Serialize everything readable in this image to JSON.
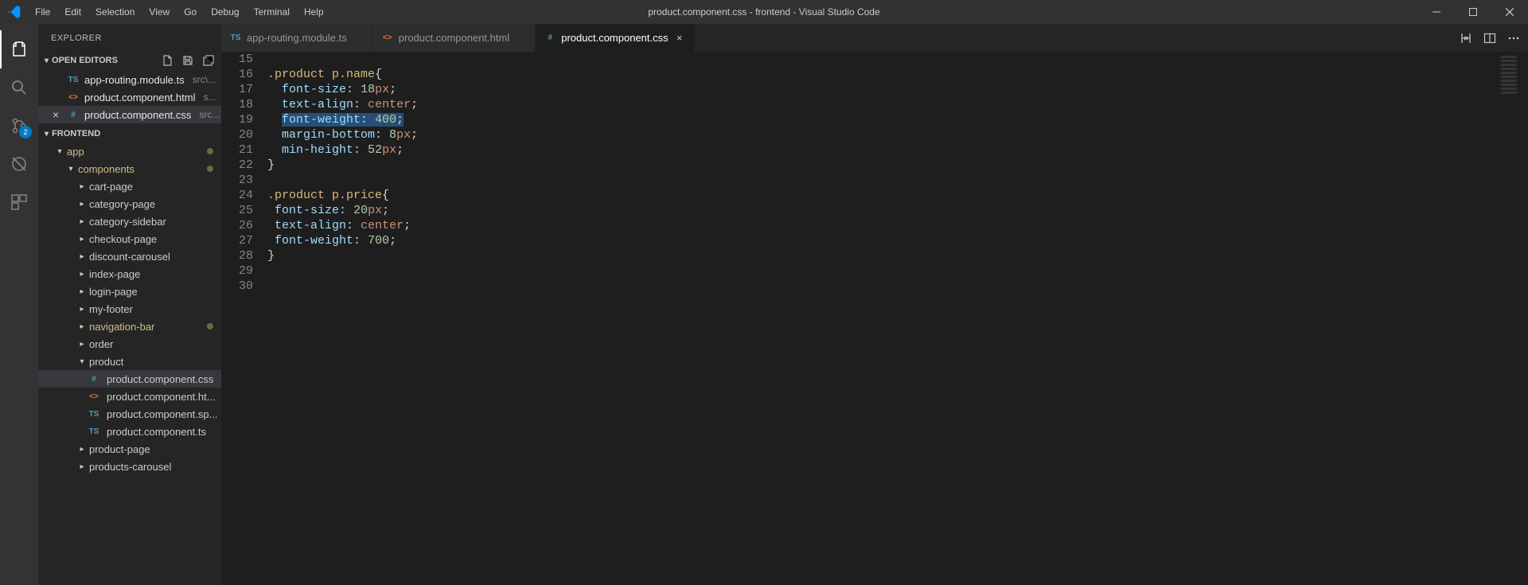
{
  "window": {
    "title": "product.component.css - frontend - Visual Studio Code"
  },
  "menu": {
    "file": "File",
    "edit": "Edit",
    "selection": "Selection",
    "view": "View",
    "go": "Go",
    "debug": "Debug",
    "terminal": "Terminal",
    "help": "Help"
  },
  "activitybar": {
    "scm_badge": "2"
  },
  "sidebar": {
    "title": "EXPLORER",
    "openEditors": {
      "header": "OPEN EDITORS",
      "items": [
        {
          "icon": "ts",
          "iconText": "TS",
          "name": "app-routing.module.ts",
          "path": "src\\..."
        },
        {
          "icon": "html",
          "iconText": "<>",
          "name": "product.component.html",
          "path": "s..."
        },
        {
          "icon": "css",
          "iconText": "#",
          "name": "product.component.css",
          "path": "src...",
          "active": true
        }
      ]
    },
    "project": {
      "header": "FRONTEND"
    },
    "tree": [
      {
        "indent": 1,
        "label": "app",
        "expanded": true,
        "twisty": "▾",
        "modified": true
      },
      {
        "indent": 2,
        "label": "components",
        "expanded": true,
        "twisty": "▾",
        "modified": true
      },
      {
        "indent": 3,
        "label": "cart-page",
        "twisty": "▸"
      },
      {
        "indent": 3,
        "label": "category-page",
        "twisty": "▸"
      },
      {
        "indent": 3,
        "label": "category-sidebar",
        "twisty": "▸"
      },
      {
        "indent": 3,
        "label": "checkout-page",
        "twisty": "▸"
      },
      {
        "indent": 3,
        "label": "discount-carousel",
        "twisty": "▸"
      },
      {
        "indent": 3,
        "label": "index-page",
        "twisty": "▸"
      },
      {
        "indent": 3,
        "label": "login-page",
        "twisty": "▸"
      },
      {
        "indent": 3,
        "label": "my-footer",
        "twisty": "▸"
      },
      {
        "indent": 3,
        "label": "navigation-bar",
        "twisty": "▸",
        "modified": true
      },
      {
        "indent": 3,
        "label": "order",
        "twisty": "▸"
      },
      {
        "indent": 3,
        "label": "product",
        "expanded": true,
        "twisty": "▾"
      },
      {
        "indent": 4,
        "label": "product.component.css",
        "icon": "css",
        "iconText": "#",
        "selected": true
      },
      {
        "indent": 4,
        "label": "product.component.ht...",
        "icon": "html",
        "iconText": "<>"
      },
      {
        "indent": 4,
        "label": "product.component.sp...",
        "icon": "ts",
        "iconText": "TS"
      },
      {
        "indent": 4,
        "label": "product.component.ts",
        "icon": "ts",
        "iconText": "TS"
      },
      {
        "indent": 3,
        "label": "product-page",
        "twisty": "▸"
      },
      {
        "indent": 3,
        "label": "products-carousel",
        "twisty": "▸"
      }
    ]
  },
  "tabs": [
    {
      "icon": "ts",
      "iconText": "TS",
      "label": "app-routing.module.ts"
    },
    {
      "icon": "html",
      "iconText": "<>",
      "label": "product.component.html"
    },
    {
      "icon": "css",
      "iconText": "#",
      "label": "product.component.css",
      "active": true
    }
  ],
  "editor": {
    "startLine": 15,
    "endLine": 30,
    "lines": {
      "15": "",
      "16": ".product p.name{",
      "17": "  font-size: 18px;",
      "18": "  text-align: center;",
      "19_prefix": "  ",
      "19_selected": "font-weight: 400;",
      "20": "  margin-bottom: 8px;",
      "21": "  min-height: 52px;",
      "22": "}",
      "23": "",
      "24": ".product p.price{",
      "25": " font-size: 20px;",
      "26": " text-align: center;",
      "27": " font-weight: 700;",
      "28": "}",
      "29": "",
      "30": ""
    }
  }
}
